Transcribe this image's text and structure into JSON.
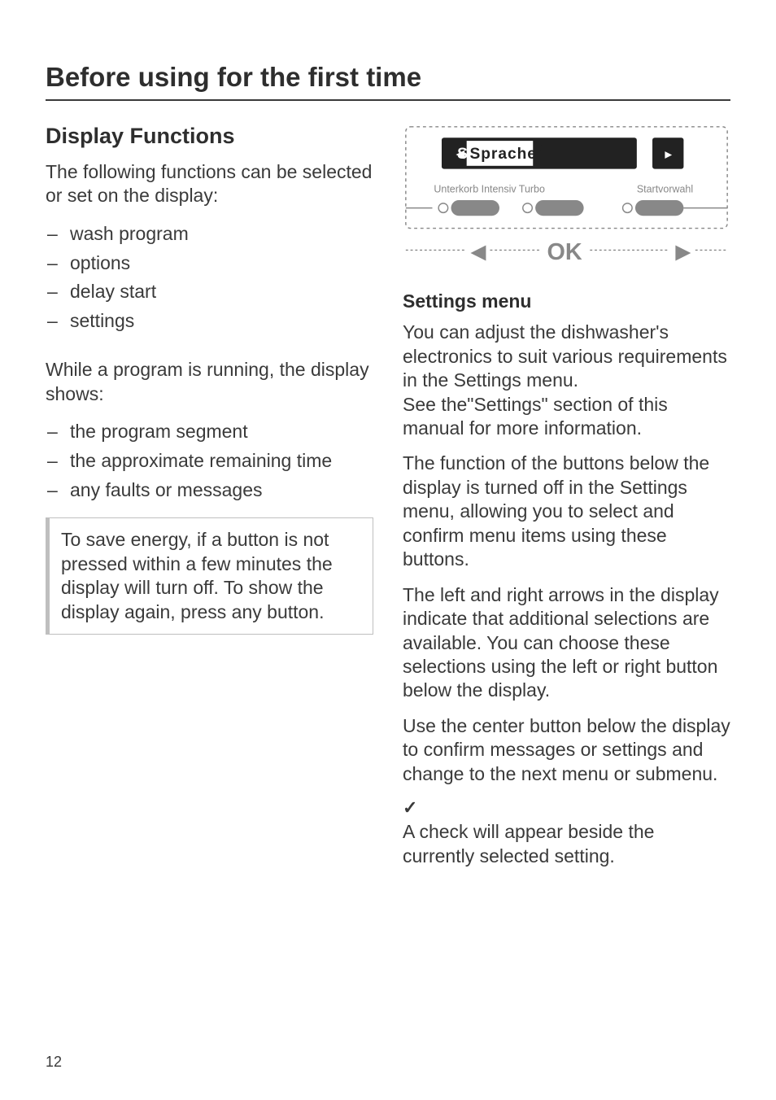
{
  "page": {
    "title": "Before using for the first time",
    "number": "12"
  },
  "left": {
    "heading": "Display Functions",
    "intro": "The following functions can be selected or set on the display:",
    "funcs": [
      "wash program",
      "options",
      "delay start",
      "settings"
    ],
    "runningIntro": "While a program is running, the display shows:",
    "runningItems": [
      "the program segment",
      "the approximate remaining time",
      "any faults or messages"
    ],
    "note": "To save energy, if a button is not pressed within a few minutes the display will turn off. To show the display again, press any button."
  },
  "right": {
    "illus": {
      "displayText": "Sprache",
      "label1": "Unterkorb Intensiv  Turbo",
      "label2": "Startvorwahl",
      "okLabel": "OK"
    },
    "heading": "Settings menu",
    "para1": "You can adjust the dishwasher's electronics to suit various requirements in the Settings menu.\nSee the\"Settings\" section of this manual for more information.",
    "para2": "The function of the buttons below the display is turned off in the Settings menu, allowing you to select and confirm menu items using these buttons.",
    "para3": "The left and right arrows in the display indicate that additional selections are available. You can choose these selections using the left or right button below the display.",
    "para4": "Use the center button below the display to confirm messages or settings and change to the next menu or submenu.",
    "checkMark": "✓",
    "para5": "A check will appear beside the currently selected setting."
  }
}
